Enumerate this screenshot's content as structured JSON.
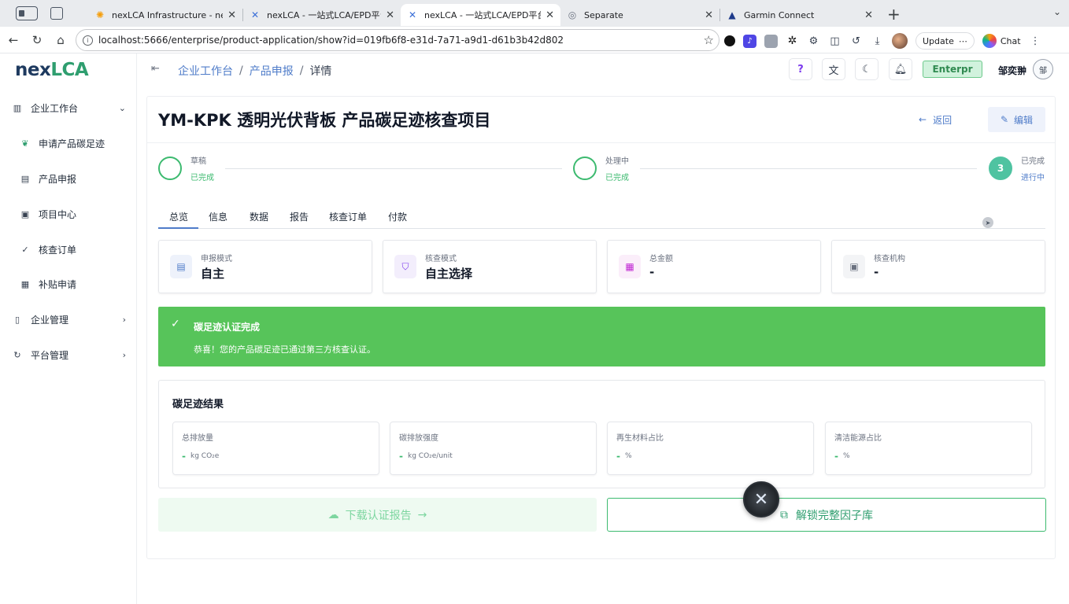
{
  "browser": {
    "tabs": [
      {
        "title": "nexLCA Infrastructure - nexLCA",
        "close": "✕"
      },
      {
        "title": "nexLCA - 一站式LCA/EPD平台",
        "close": "✕"
      },
      {
        "title": "nexLCA - 一站式LCA/EPD平台",
        "close": "✕"
      },
      {
        "title": "Separate",
        "close": "✕"
      },
      {
        "title": "Garmin Connect",
        "close": "✕"
      }
    ],
    "new_tab": "+",
    "url": "localhost:5666/enterprise/product-application/show?id=019fb6f8-e31d-7a71-a9d1-d61b3b42d802",
    "update_label": "Update",
    "chat_label": "Chat"
  },
  "app": {
    "logo": {
      "prefix": "nex",
      "suffix": "LCA"
    },
    "sidebar": {
      "items": [
        {
          "label": "企业工作台",
          "icon": "building-icon"
        },
        {
          "label": "申请产品碳足迹",
          "icon": "leaf-icon"
        },
        {
          "label": "产品申报",
          "icon": "clipboard-icon"
        },
        {
          "label": "项目中心",
          "icon": "briefcase-icon"
        },
        {
          "label": "核查订单",
          "icon": "check-icon"
        },
        {
          "label": "补贴申请",
          "icon": "receipt-icon"
        },
        {
          "label": "企业管理",
          "icon": "office-icon"
        },
        {
          "label": "平台管理",
          "icon": "refresh-icon"
        }
      ]
    },
    "header": {
      "breadcrumb": [
        "企业工作台",
        "产品申报",
        "详情"
      ],
      "breadcrumb_sep": "/",
      "help": "?",
      "plan": "Enterpr",
      "user_name": "邹奕翀",
      "user_initial": "邹"
    }
  },
  "project": {
    "title": "YM-KPK 透明光伏背板 产品碳足迹核查项目",
    "back_label": "返回",
    "edit_label": "编辑",
    "steps": [
      {
        "title": "草稿",
        "status": "已完成"
      },
      {
        "title": "处理中",
        "status": "已完成"
      },
      {
        "number": "3",
        "title": "已完成",
        "status": "进行中"
      }
    ],
    "tabs": [
      "总览",
      "信息",
      "数据",
      "报告",
      "核查订单",
      "付款"
    ],
    "info_cards": [
      {
        "label": "申报模式",
        "value": "自主"
      },
      {
        "label": "核查模式",
        "value": "自主选择"
      },
      {
        "label": "总金额",
        "value": "-"
      },
      {
        "label": "核查机构",
        "value": "-"
      }
    ],
    "banner": {
      "title": "碳足迹认证完成",
      "message": "恭喜！您的产品碳足迹已通过第三方核查认证。"
    },
    "results": {
      "title": "碳足迹结果",
      "metrics": [
        {
          "label": "总排放量",
          "value": "-",
          "unit": "kg CO₂e"
        },
        {
          "label": "碳排放强度",
          "value": "-",
          "unit": "kg CO₂e/unit"
        },
        {
          "label": "再生材料占比",
          "value": "-",
          "unit": "%"
        },
        {
          "label": "清洁能源占比",
          "value": "-",
          "unit": "%"
        }
      ]
    },
    "download_label": "下载认证报告",
    "unlock_label": "解锁完整因子库"
  },
  "colors": {
    "accent": "#4f7cc9",
    "success": "#57c45a",
    "brand_green": "#2f9e6f"
  }
}
